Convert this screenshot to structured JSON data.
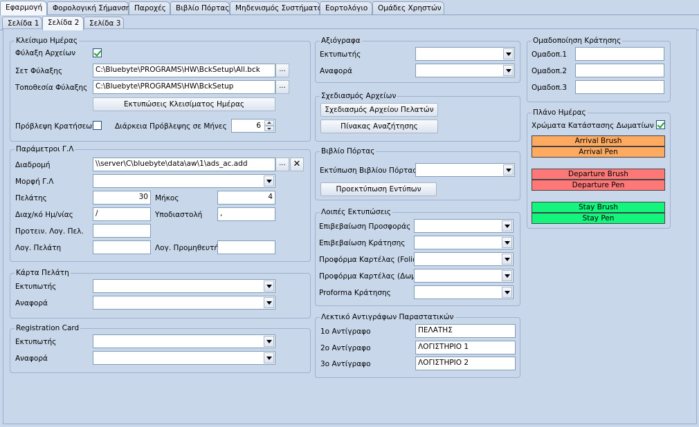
{
  "tabs_top": [
    "Εφαρμογή",
    "Φορολογική Σήμανση",
    "Παροχές",
    "Βιβλίο Πόρτας",
    "Μηδενισμός Συστήματος",
    "Εορτολόγιο",
    "Ομάδες Χρηστών"
  ],
  "tabs_sub": [
    "Σελίδα 1",
    "Σελίδα 2",
    "Σελίδα 3"
  ],
  "day_close": {
    "title": "Κλείσιμο Ημέρας",
    "backup_files_label": "Φύλαξη Αρχείων",
    "backup_files_checked": true,
    "backup_set_label": "Σετ Φύλαξης",
    "backup_set_value": "C:\\Bluebyte\\PROGRAMS\\HW\\BckSetup\\All.bck",
    "backup_location_label": "Τοποθεσία Φύλαξης",
    "backup_location_value": "C:\\Bluebyte\\PROGRAMS\\HW\\BckSetup",
    "print_button": "Εκτυπώσεις Κλεισίματος Ημέρας",
    "forecast_label": "Πρόβλεψη Κρατήσεων",
    "forecast_checked": false,
    "forecast_months_label": "Διάρκεια Πρόβλεψης σε Μήνες",
    "forecast_months_value": "6",
    "ellipsis": "..."
  },
  "gl_params": {
    "title": "Παράμετροι Γ.Λ",
    "path_label": "Διαδρομή",
    "path_value": "\\\\server\\C\\bluebyte\\data\\aw\\1\\ads_ac.add",
    "format_label": "Μορφή Γ.Λ",
    "customer_label": "Πελάτης",
    "customer_value": "30",
    "length_label": "Μήκος",
    "length_value": "4",
    "date_sep_label": "Διαχ/κό Ημ/νίας",
    "date_sep_value": "/",
    "decimal_label": "Υποδιαστολή",
    "decimal_value": ",",
    "prefix_label": "Προτειν. Λογ. Πελ.",
    "cust_account_label": "Λογ. Πελάτη",
    "supplier_account_label": "Λογ. Προμηθευτή",
    "clear_icon": "✕"
  },
  "customer_card": {
    "title": "Κάρτα Πελάτη",
    "printer_label": "Εκτυπωτής",
    "report_label": "Αναφορά"
  },
  "registration_card": {
    "title": "Registration Card",
    "printer_label": "Εκτυπωτής",
    "report_label": "Αναφορά"
  },
  "receipts": {
    "title": "Αξιόγραφα",
    "printer_label": "Εκτυπωτής",
    "report_label": "Αναφορά"
  },
  "file_design": {
    "title": "Σχεδιασμός Αρχείων",
    "customer_file_button": "Σχεδιασμός Αρχείου Πελατών",
    "lookup_table_button": "Πίνακας Αναζήτησης"
  },
  "door_book": {
    "title": "Βιβλίο Πόρτας",
    "print_label": "Εκτύπωση Βιβλίου Πόρτας",
    "preview_button": "Προεκτύπωση Εντύπων"
  },
  "other_prints": {
    "title": "Λοιπές Εκτυπώσεις",
    "items": [
      "Επιβεβαίωση Προσφοράς",
      "Επιβεβαίωση Κράτησης",
      "Προφόρμα Καρτέλας (Folio)",
      "Προφόρμα Καρτέλας (Δωμ.)",
      "Proforma Κράτησης"
    ]
  },
  "copies_text": {
    "title": "Λεκτικό Αντιγράφων Παραστατικών",
    "rows": [
      {
        "label": "1ο Αντίγραφο",
        "value": "ΠΕΛΑΤΗΣ"
      },
      {
        "label": "2ο Αντίγραφο",
        "value": "ΛΟΓΙΣΤΗΡΙΟ 1"
      },
      {
        "label": "3ο Αντίγραφο",
        "value": "ΛΟΓΙΣΤΗΡΙΟ 2"
      }
    ]
  },
  "booking_grouping": {
    "title": "Ομαδοποίηση Κράτησης",
    "labels": [
      "Ομαδοπ.1",
      "Ομαδοπ.2",
      "Ομαδοπ.3"
    ]
  },
  "day_plan": {
    "title": "Πλάνο Ημέρας",
    "room_colors_label": "Χρώματα Κατάστασης Δωματίων",
    "room_colors_checked": true,
    "swatches": [
      {
        "label": "Arrival Brush",
        "color": "#ffaa60"
      },
      {
        "label": "Arrival Pen",
        "color": "#ffaa60"
      },
      {
        "label": "Departure Brush",
        "color": "#ff7878"
      },
      {
        "label": "Departure Pen",
        "color": "#ff7878"
      },
      {
        "label": "Stay Brush",
        "color": "#14f57d"
      },
      {
        "label": "Stay Pen",
        "color": "#14f57d"
      }
    ]
  }
}
